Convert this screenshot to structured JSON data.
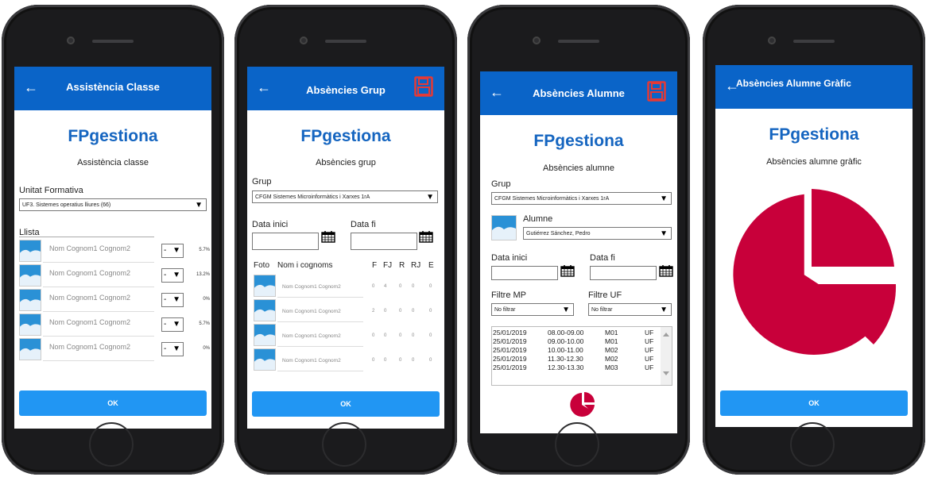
{
  "brand": "FPgestiona",
  "ok_label": "OK",
  "back_glyph": "←",
  "dropdown_glyph": "▼",
  "colors": {
    "appbar": "#0a64c8",
    "brand_text": "#1565c0",
    "ok_button": "#2196f3",
    "pie": "#c8003a",
    "save_icon": "#e53935"
  },
  "screen1": {
    "title": "Assistència Classe",
    "subtitle": "Assistència classe",
    "uf_label": "Unitat Formativa",
    "uf_value": "UF3. Sistemes operatius lliures (66)",
    "list_label": "Llista",
    "dd_value": "-",
    "rows": [
      {
        "name": "Nom Cognom1 Cognom2",
        "pct": "5.7%"
      },
      {
        "name": "Nom Cognom1 Cognom2",
        "pct": "13.2%"
      },
      {
        "name": "Nom Cognom1 Cognom2",
        "pct": "0%"
      },
      {
        "name": "Nom Cognom1 Cognom2",
        "pct": "5.7%"
      },
      {
        "name": "Nom Cognom1 Cognom2",
        "pct": "0%"
      }
    ]
  },
  "screen2": {
    "title": "Absències Grup",
    "subtitle": "Absències grup",
    "group_label": "Grup",
    "group_value": "CFGM Sistemes Microinformàtics i Xarxes 1rA",
    "start_label": "Data inici",
    "end_label": "Data fi",
    "headers": {
      "photo": "Foto",
      "name": "Nom i cognoms",
      "f": "F",
      "fj": "FJ",
      "r": "R",
      "rj": "RJ",
      "e": "E"
    },
    "rows": [
      {
        "name": "Nom Cognom1 Cognom2",
        "f": "0",
        "fj": "4",
        "r": "0",
        "rj": "0",
        "e": "0"
      },
      {
        "name": "Nom Cognom1 Cognom2",
        "f": "2",
        "fj": "0",
        "r": "0",
        "rj": "0",
        "e": "0"
      },
      {
        "name": "Nom Cognom1 Cognom2",
        "f": "0",
        "fj": "0",
        "r": "0",
        "rj": "0",
        "e": "0"
      },
      {
        "name": "Nom Cognom1 Cognom2",
        "f": "0",
        "fj": "0",
        "r": "0",
        "rj": "0",
        "e": "0"
      }
    ]
  },
  "screen3": {
    "title": "Absències Alumne",
    "subtitle": "Absències alumne",
    "group_label": "Grup",
    "group_value": "CFGM Sistemes Microinformàtics i Xarxes 1rA",
    "student_label": "Alumne",
    "student_value": "Gutiérrez Sánchez, Pedro",
    "start_label": "Data inici",
    "end_label": "Data fi",
    "mp_label": "Filtre MP",
    "mp_value": "No filtrar",
    "uf_label": "Filtre UF",
    "uf_value": "No filtrar",
    "absences": [
      {
        "date": "25/01/2019",
        "time": "08.00-09.00",
        "module": "M01",
        "uf": "UF"
      },
      {
        "date": "25/01/2019",
        "time": "09.00-10.00",
        "module": "M01",
        "uf": "UF"
      },
      {
        "date": "25/01/2019",
        "time": "10.00-11.00",
        "module": "M02",
        "uf": "UF"
      },
      {
        "date": "25/01/2019",
        "time": "11.30-12.30",
        "module": "M02",
        "uf": "UF"
      },
      {
        "date": "25/01/2019",
        "time": "12.30-13.30",
        "module": "M03",
        "uf": "UF"
      }
    ]
  },
  "screen4": {
    "title": "Absències Alumne Gràfic",
    "subtitle": "Absències alumne gràfic"
  }
}
